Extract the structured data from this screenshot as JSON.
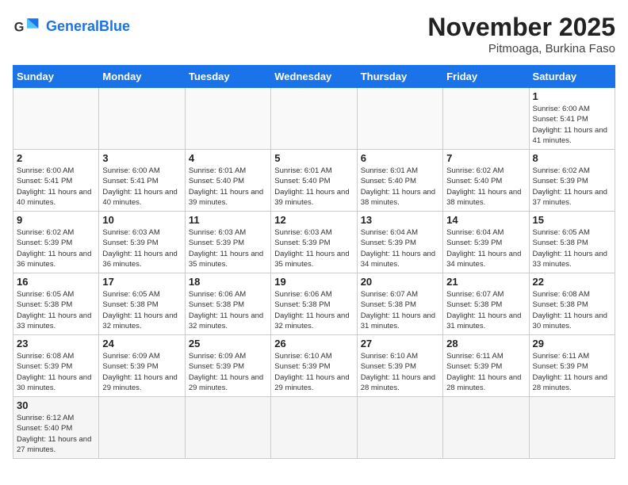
{
  "header": {
    "logo_general": "General",
    "logo_blue": "Blue",
    "month": "November 2025",
    "location": "Pitmoaga, Burkina Faso"
  },
  "days_of_week": [
    "Sunday",
    "Monday",
    "Tuesday",
    "Wednesday",
    "Thursday",
    "Friday",
    "Saturday"
  ],
  "weeks": [
    [
      {
        "day": "",
        "info": ""
      },
      {
        "day": "",
        "info": ""
      },
      {
        "day": "",
        "info": ""
      },
      {
        "day": "",
        "info": ""
      },
      {
        "day": "",
        "info": ""
      },
      {
        "day": "",
        "info": ""
      },
      {
        "day": "1",
        "info": "Sunrise: 6:00 AM\nSunset: 5:41 PM\nDaylight: 11 hours\nand 41 minutes."
      }
    ],
    [
      {
        "day": "2",
        "info": "Sunrise: 6:00 AM\nSunset: 5:41 PM\nDaylight: 11 hours\nand 40 minutes."
      },
      {
        "day": "3",
        "info": "Sunrise: 6:00 AM\nSunset: 5:41 PM\nDaylight: 11 hours\nand 40 minutes."
      },
      {
        "day": "4",
        "info": "Sunrise: 6:01 AM\nSunset: 5:40 PM\nDaylight: 11 hours\nand 39 minutes."
      },
      {
        "day": "5",
        "info": "Sunrise: 6:01 AM\nSunset: 5:40 PM\nDaylight: 11 hours\nand 39 minutes."
      },
      {
        "day": "6",
        "info": "Sunrise: 6:01 AM\nSunset: 5:40 PM\nDaylight: 11 hours\nand 38 minutes."
      },
      {
        "day": "7",
        "info": "Sunrise: 6:02 AM\nSunset: 5:40 PM\nDaylight: 11 hours\nand 38 minutes."
      },
      {
        "day": "8",
        "info": "Sunrise: 6:02 AM\nSunset: 5:39 PM\nDaylight: 11 hours\nand 37 minutes."
      }
    ],
    [
      {
        "day": "9",
        "info": "Sunrise: 6:02 AM\nSunset: 5:39 PM\nDaylight: 11 hours\nand 36 minutes."
      },
      {
        "day": "10",
        "info": "Sunrise: 6:03 AM\nSunset: 5:39 PM\nDaylight: 11 hours\nand 36 minutes."
      },
      {
        "day": "11",
        "info": "Sunrise: 6:03 AM\nSunset: 5:39 PM\nDaylight: 11 hours\nand 35 minutes."
      },
      {
        "day": "12",
        "info": "Sunrise: 6:03 AM\nSunset: 5:39 PM\nDaylight: 11 hours\nand 35 minutes."
      },
      {
        "day": "13",
        "info": "Sunrise: 6:04 AM\nSunset: 5:39 PM\nDaylight: 11 hours\nand 34 minutes."
      },
      {
        "day": "14",
        "info": "Sunrise: 6:04 AM\nSunset: 5:39 PM\nDaylight: 11 hours\nand 34 minutes."
      },
      {
        "day": "15",
        "info": "Sunrise: 6:05 AM\nSunset: 5:38 PM\nDaylight: 11 hours\nand 33 minutes."
      }
    ],
    [
      {
        "day": "16",
        "info": "Sunrise: 6:05 AM\nSunset: 5:38 PM\nDaylight: 11 hours\nand 33 minutes."
      },
      {
        "day": "17",
        "info": "Sunrise: 6:05 AM\nSunset: 5:38 PM\nDaylight: 11 hours\nand 32 minutes."
      },
      {
        "day": "18",
        "info": "Sunrise: 6:06 AM\nSunset: 5:38 PM\nDaylight: 11 hours\nand 32 minutes."
      },
      {
        "day": "19",
        "info": "Sunrise: 6:06 AM\nSunset: 5:38 PM\nDaylight: 11 hours\nand 32 minutes."
      },
      {
        "day": "20",
        "info": "Sunrise: 6:07 AM\nSunset: 5:38 PM\nDaylight: 11 hours\nand 31 minutes."
      },
      {
        "day": "21",
        "info": "Sunrise: 6:07 AM\nSunset: 5:38 PM\nDaylight: 11 hours\nand 31 minutes."
      },
      {
        "day": "22",
        "info": "Sunrise: 6:08 AM\nSunset: 5:38 PM\nDaylight: 11 hours\nand 30 minutes."
      }
    ],
    [
      {
        "day": "23",
        "info": "Sunrise: 6:08 AM\nSunset: 5:39 PM\nDaylight: 11 hours\nand 30 minutes."
      },
      {
        "day": "24",
        "info": "Sunrise: 6:09 AM\nSunset: 5:39 PM\nDaylight: 11 hours\nand 29 minutes."
      },
      {
        "day": "25",
        "info": "Sunrise: 6:09 AM\nSunset: 5:39 PM\nDaylight: 11 hours\nand 29 minutes."
      },
      {
        "day": "26",
        "info": "Sunrise: 6:10 AM\nSunset: 5:39 PM\nDaylight: 11 hours\nand 29 minutes."
      },
      {
        "day": "27",
        "info": "Sunrise: 6:10 AM\nSunset: 5:39 PM\nDaylight: 11 hours\nand 28 minutes."
      },
      {
        "day": "28",
        "info": "Sunrise: 6:11 AM\nSunset: 5:39 PM\nDaylight: 11 hours\nand 28 minutes."
      },
      {
        "day": "29",
        "info": "Sunrise: 6:11 AM\nSunset: 5:39 PM\nDaylight: 11 hours\nand 28 minutes."
      }
    ],
    [
      {
        "day": "30",
        "info": "Sunrise: 6:12 AM\nSunset: 5:40 PM\nDaylight: 11 hours\nand 27 minutes."
      },
      {
        "day": "",
        "info": ""
      },
      {
        "day": "",
        "info": ""
      },
      {
        "day": "",
        "info": ""
      },
      {
        "day": "",
        "info": ""
      },
      {
        "day": "",
        "info": ""
      },
      {
        "day": "",
        "info": ""
      }
    ]
  ]
}
